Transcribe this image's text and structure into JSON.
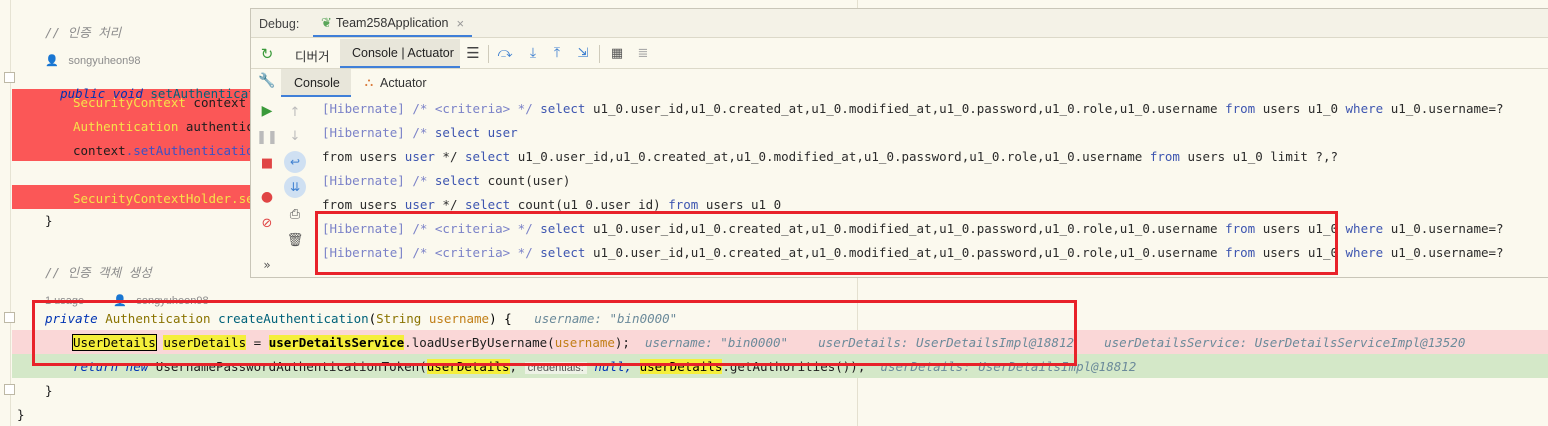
{
  "editor": {
    "comment1": "// 인증 처리",
    "author1": "songyuheon98",
    "method1_sig_kw": "public void",
    "method1_name": "setAuthentication",
    "l_sec_ctx": "SecurityContext",
    "l_sec_ctx_rest": " context = ",
    "l_auth": "Authentication",
    "l_auth_rest": " authentica",
    "l_context": "context",
    "l_context_rest": ".setAuthentication",
    "l_holder": "SecurityContextHolder.setC",
    "close1": "}",
    "comment2": "// 인증 객체 생성",
    "usage": "1 usage",
    "author2": "songyuheon98",
    "private_kw": "private",
    "ret_type": "Authentication",
    "method2_name": "createAuthentication",
    "param_type": "String",
    "param_name": "username",
    "sig_end": ") {",
    "sig_hint": "username: \"bin0000\"",
    "ud_type": "UserDetails",
    "ud_var": "userDetails",
    "ud_eq": " = ",
    "ud_service": "userDetailsService",
    "ud_call": ".loadUserByUsername(",
    "ud_arg": "username",
    "ud_end": ");",
    "ud_hint1": "username: \"bin0000\"",
    "ud_hint2": "userDetails: UserDetailsImpl@18812",
    "ud_hint3": "userDetailsService: UserDetailsServiceImpl@13520",
    "ret_kw": "return new",
    "ret_class": "UsernamePasswordAuthenticationToken(",
    "ret_arg1": "userDetails",
    "ret_comma": ",",
    "ret_cred_label": "credentials:",
    "ret_null": "null,",
    "ret_arg2": "userDetails",
    "ret_getauth": ".getAuthorities());",
    "ret_hint": "userDetails: UserDetailsImpl@18812",
    "close2": "}",
    "close3": "}"
  },
  "debug": {
    "label": "Debug:",
    "run_tab": "Team258Application",
    "tab_debugger": "디버거",
    "tab_console_actuator": "Console | Actuator",
    "subtab_console": "Console",
    "subtab_actuator": "Actuator",
    "more": "»"
  },
  "console": {
    "lines": [
      {
        "p1": "[Hibernate]",
        "p2": " /* <criteria> */ ",
        "p3": "select",
        "p4": " u1_0.user_id,u1_0.created_at,u1_0.modified_at,u1_0.password,u1_0.role,u1_0.username ",
        "p5": "from",
        "p6": " users u1_0 ",
        "p7": "where",
        "p8": " u1_0.username=?"
      },
      {
        "p1": "[Hibernate]",
        "p2": " /* ",
        "p3": "select",
        "p4": " user",
        "p5": "",
        "p6": "",
        "p7": "",
        "p8": ""
      },
      {
        "p1": "",
        "p2": "from users ",
        "p3": "user",
        "p4": " */ ",
        "p5": "select",
        "p6": " u1_0.user_id,u1_0.created_at,u1_0.modified_at,u1_0.password,u1_0.role,u1_0.username ",
        "p7": "from",
        "p8": " users u1_0 limit ?,?"
      },
      {
        "p1": "[Hibernate]",
        "p2": " /* ",
        "p3": "select",
        "p4": " count(user)",
        "p5": "",
        "p6": "",
        "p7": "",
        "p8": ""
      },
      {
        "p1": "",
        "p2": "from users ",
        "p3": "user",
        "p4": " */ ",
        "p5": "select",
        "p6": " count(u1_0.user_id) ",
        "p7": "from",
        "p8": " users u1_0"
      },
      {
        "p1": "[Hibernate]",
        "p2": " /* <criteria> */ ",
        "p3": "select",
        "p4": " u1_0.user_id,u1_0.created_at,u1_0.modified_at,u1_0.password,u1_0.role,u1_0.username ",
        "p5": "from",
        "p6": " users u1_0 ",
        "p7": "where",
        "p8": " u1_0.username=?"
      },
      {
        "p1": "[Hibernate]",
        "p2": " /* <criteria> */ ",
        "p3": "select",
        "p4": " u1_0.user_id,u1_0.created_at,u1_0.modified_at,u1_0.password,u1_0.role,u1_0.username ",
        "p5": "from",
        "p6": " users u1_0 ",
        "p7": "where",
        "p8": " u1_0.username=?"
      }
    ]
  },
  "colors": {
    "accent_red": "#e8222a",
    "breakpoint_line": "#fb5757",
    "current_line": "#fad7d7",
    "exec_line": "#d4e8c8",
    "highlight": "#f5ef3b"
  }
}
